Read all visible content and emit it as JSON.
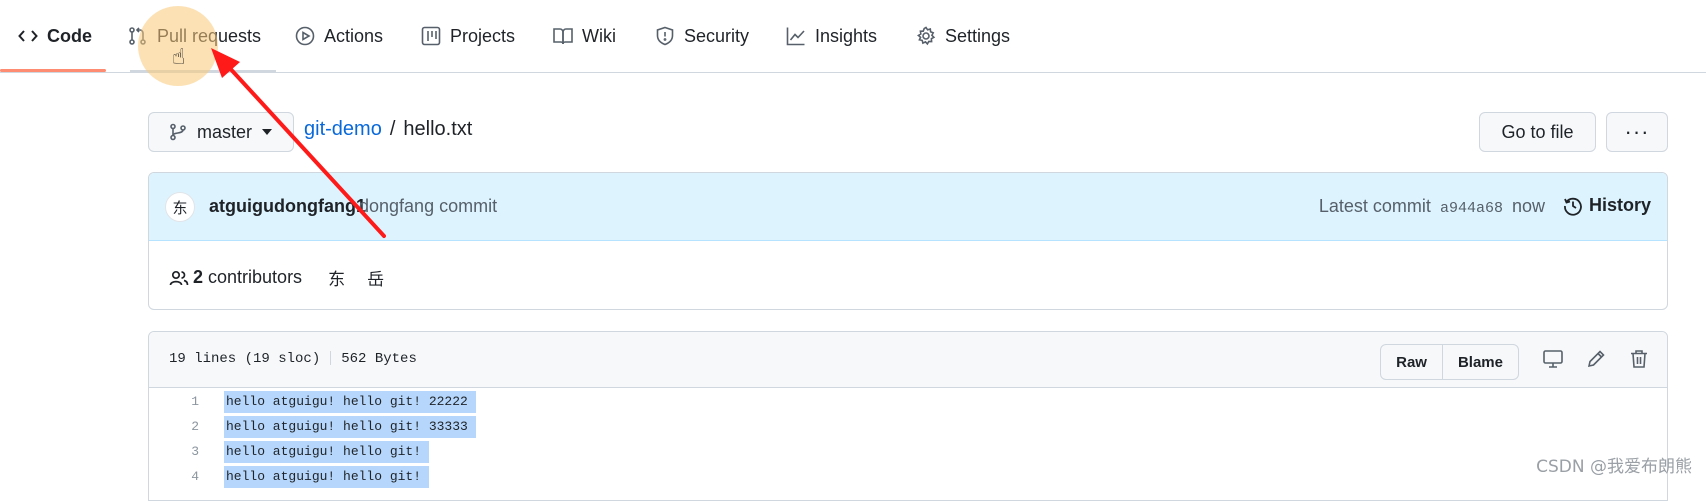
{
  "nav": {
    "tabs": [
      {
        "label": "Code",
        "icon": "code-icon"
      },
      {
        "label": "Pull requests",
        "icon": "pull-request-icon"
      },
      {
        "label": "Actions",
        "icon": "play-icon"
      },
      {
        "label": "Projects",
        "icon": "table-icon"
      },
      {
        "label": "Wiki",
        "icon": "book-icon"
      },
      {
        "label": "Security",
        "icon": "shield-icon"
      },
      {
        "label": "Insights",
        "icon": "graph-icon"
      },
      {
        "label": "Settings",
        "icon": "gear-icon"
      }
    ],
    "active_tab": "Code",
    "accent_color": "#fd8c73"
  },
  "file_nav": {
    "branch": "master",
    "repo": "git-demo",
    "separator": "/",
    "file": "hello.txt",
    "goto_label": "Go to file",
    "more_label": "···"
  },
  "commit": {
    "avatar_char": "东",
    "author": "atguigudongfang1",
    "message": "dongfang commit",
    "latest_label": "Latest commit",
    "sha": "a944a68",
    "time": "now",
    "history_label": "History",
    "contributors_count": "2",
    "contributors_label": "contributors",
    "contributor_avatars": [
      "东",
      "岳"
    ]
  },
  "file": {
    "lines_info": "19 lines (19 sloc)",
    "size": "562 Bytes",
    "raw_label": "Raw",
    "blame_label": "Blame",
    "code_lines": [
      {
        "n": "1",
        "text": "hello atguigu! hello git! 22222"
      },
      {
        "n": "2",
        "text": "hello atguigu! hello git! 33333"
      },
      {
        "n": "3",
        "text": "hello atguigu! hello git!"
      },
      {
        "n": "4",
        "text": "hello atguigu! hello git!"
      }
    ]
  },
  "watermark": "CSDN @我爱布朗熊",
  "annotation_color": "#ff1a1a"
}
